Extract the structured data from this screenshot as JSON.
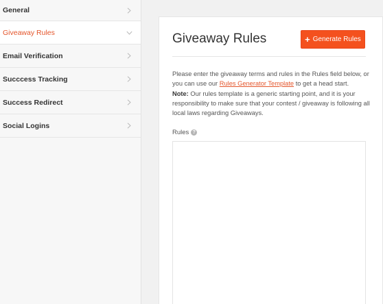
{
  "sidebar": {
    "items": [
      {
        "label": "General",
        "active": false
      },
      {
        "label": "Giveaway Rules",
        "active": true
      },
      {
        "label": "Email Verification",
        "active": false
      },
      {
        "label": "Succcess Tracking",
        "active": false
      },
      {
        "label": "Success Redirect",
        "active": false
      },
      {
        "label": "Social Logins",
        "active": false
      }
    ]
  },
  "main": {
    "title": "Giveaway Rules",
    "generate_button_label": "Generate Rules",
    "generate_button_icon": "plus-icon",
    "description": {
      "intro_before_link": "Please enter the giveaway terms and rules in the Rules field below, or you can use our ",
      "link_text": "Rules Generator Template",
      "intro_after_link": " to get a head start.",
      "note_label": "Note:",
      "note_text": " Our rules template is a generic starting point, and it is your responsibility to make sure that your contest / giveaway is following all local laws regarding Giveaways."
    },
    "rules_label": "Rules",
    "help_icon_glyph": "?",
    "rules_value": ""
  },
  "colors": {
    "accent": "#f4511e",
    "active_text": "#e4552b",
    "sidebar_bg": "#f7f7f7",
    "page_bg": "#f1f1f1"
  }
}
